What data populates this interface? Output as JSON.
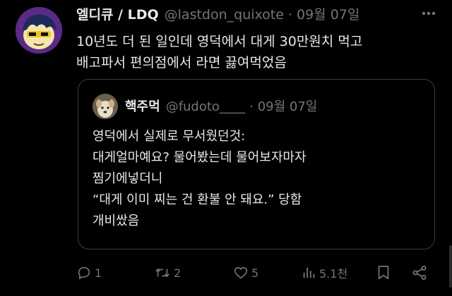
{
  "tweet": {
    "author_name": "엘디큐 / LDQ",
    "author_handle": "@lastdon_quixote",
    "separator": "·",
    "date": "09월 07일",
    "text": "10년도 더 된 일인데  영덕에서 대게 30만원치 먹고\n배고파서 편의점에서 라면 끓여먹었음",
    "avatar_icon": "cartoon-avatar"
  },
  "quoted_tweet": {
    "author_name": "핵주먹",
    "author_handle": "@fudoto____",
    "separator": "·",
    "date": "09월 07일",
    "text": "영덕에서 실제로 무서웠던것:\n대게얼마예요? 물어봤는데 물어보자마자\n찜기에넣더니\n“대게 이미 찌는 건 환불 안 돼요.” 당함\n개비쌌음",
    "avatar_icon": "dog-photo-avatar"
  },
  "actions": {
    "reply_count": "1",
    "retweet_count": "2",
    "like_count": "5",
    "views_count": "5.1천"
  },
  "colors": {
    "background": "#000000",
    "text_primary": "#e7e9ea",
    "text_secondary": "#71767b",
    "border": "#3a3d42",
    "avatar_bg": "#5b2a86"
  }
}
